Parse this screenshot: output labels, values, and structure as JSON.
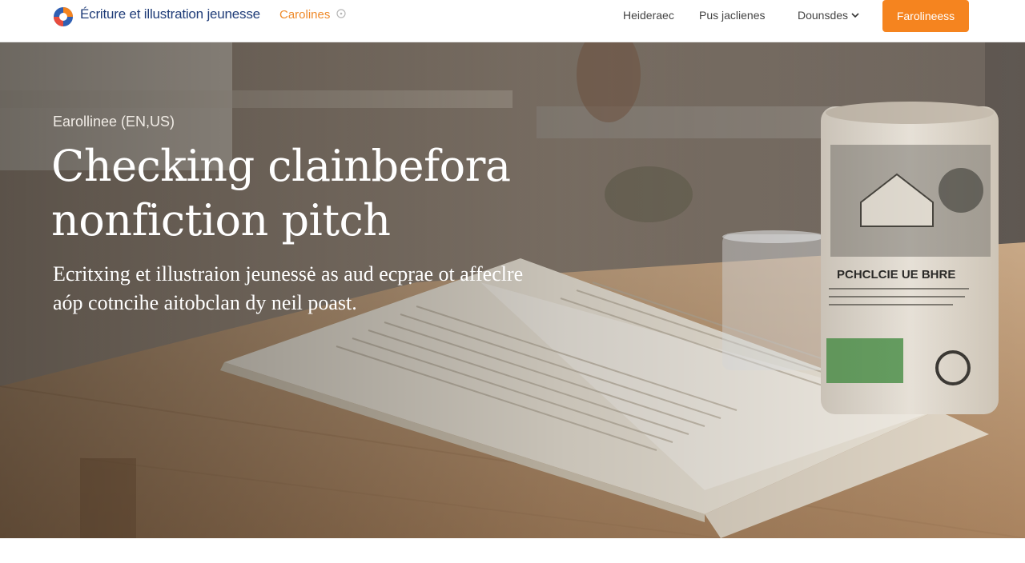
{
  "header": {
    "brand_name": "Écriture et illustration jeunesse",
    "brand_tag": "Carolines",
    "nav": [
      {
        "label": "Heideraec"
      },
      {
        "label": "Pus jaclienes"
      },
      {
        "label": "Dounsdes"
      }
    ],
    "cta_label": "Farolineess",
    "colors": {
      "accent": "#f5841f",
      "brand": "#1f3c78"
    }
  },
  "hero": {
    "eyebrow": "Earollinee (EN,US)",
    "title": "Checking clainbefora nonfiction pitch",
    "subtitle": "Ecritxing et illustraion jeunessė as aud ecpṛae ot affeclre aóp cotncihe aitobclan dy neil poast.",
    "tin_label": "PCHCLCIE UE BHRE"
  }
}
